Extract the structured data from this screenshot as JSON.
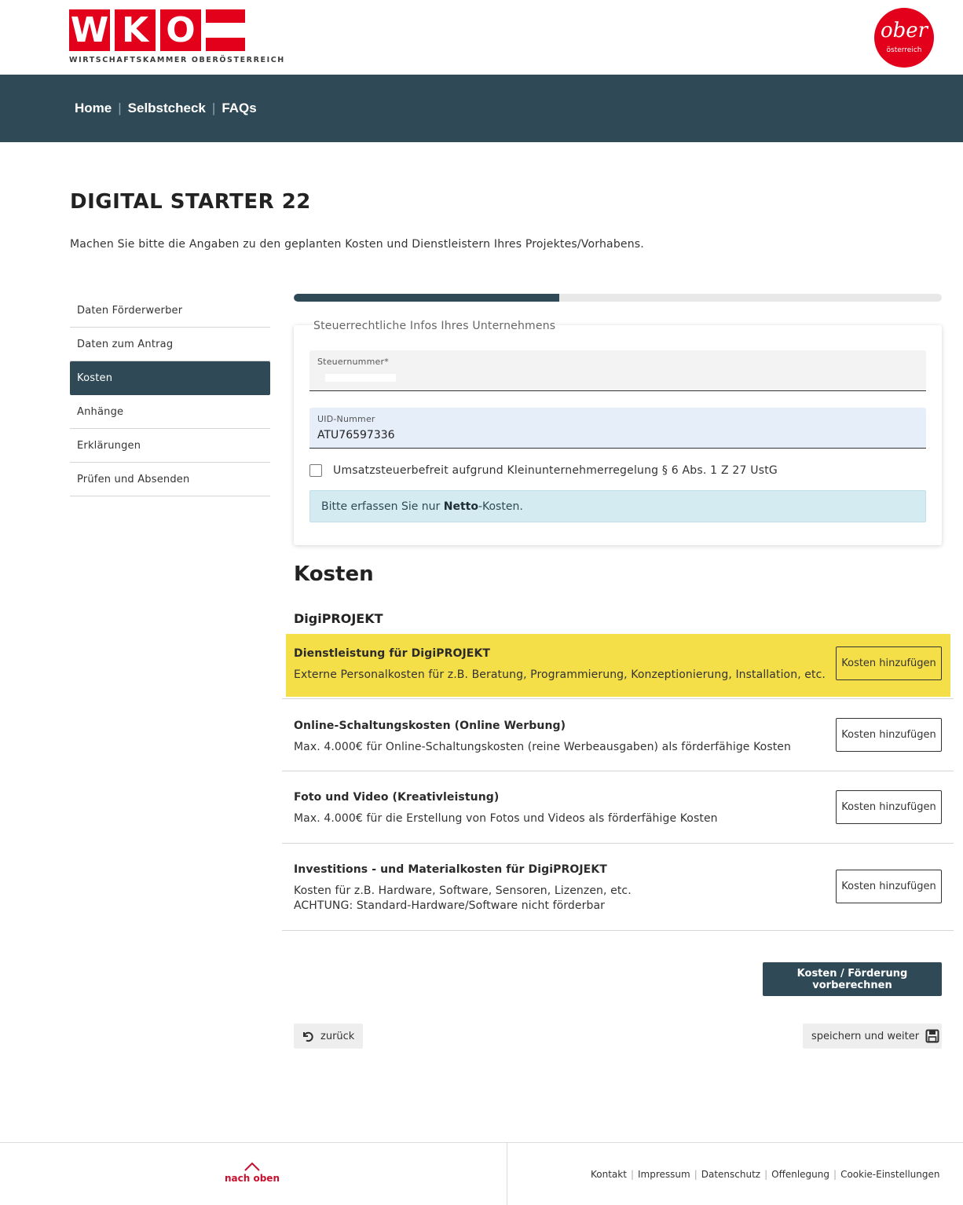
{
  "header": {
    "logo_letters": [
      "W",
      "K",
      "O"
    ],
    "logo_subtitle": "WIRTSCHAFTSKAMMER OBERÖSTERREICH",
    "region_logo_main": "ober",
    "region_logo_sub": "österreich",
    "brand_color": "#e2001a"
  },
  "nav": {
    "items": [
      "Home",
      "Selbstcheck",
      "FAQs"
    ],
    "background": "#2f4a56"
  },
  "page": {
    "title": "DIGITAL STARTER 22",
    "intro": "Machen Sie bitte die Angaben zu den geplanten Kosten und Dienstleistern Ihres Projektes/Vorhabens."
  },
  "sidebar": {
    "items": [
      {
        "label": "Daten Förderwerber"
      },
      {
        "label": "Daten zum Antrag"
      },
      {
        "label": "Kosten"
      },
      {
        "label": "Anhänge"
      },
      {
        "label": "Erklärungen"
      },
      {
        "label": "Prüfen und Absenden"
      }
    ],
    "active": "Kosten"
  },
  "progress": {
    "value": 0.41
  },
  "tax_card": {
    "legend": "Steuerrechtliche Infos Ihres Unternehmens",
    "steuernummer_label": "Steuernummer*",
    "steuernummer_value": "",
    "uid_label": "UID-Nummer",
    "uid_value": "ATU76597336",
    "checkbox_label": "Umsatzsteuerbefreit aufgrund Kleinunternehmerregelung § 6 Abs. 1 Z 27 UstG",
    "checkbox_checked": false,
    "info_prefix": "Bitte erfassen Sie nur ",
    "info_bold": "Netto",
    "info_suffix": "-Kosten."
  },
  "costs": {
    "heading": "Kosten",
    "subheading": "DigiPROJEKT",
    "add_label": "Kosten hinzufügen",
    "rows": [
      {
        "title": "Dienstleistung für DigiPROJEKT",
        "desc": "Externe Personalkosten für z.B. Beratung, Programmierung, Konzeptionierung, Installation, etc.",
        "desc2": ""
      },
      {
        "title": "Online-Schaltungskosten (Online Werbung)",
        "desc": "Max. 4.000€ für Online-Schaltungskosten (reine Werbeausgaben) als förderfähige Kosten",
        "desc2": ""
      },
      {
        "title": "Foto und Video (Kreativleistung)",
        "desc": "Max. 4.000€ für die Erstellung von Fotos und Videos als förderfähige Kosten",
        "desc2": ""
      },
      {
        "title": "Investitions - und Materialkosten für DigiPROJEKT",
        "desc": "Kosten für z.B. Hardware, Software, Sensoren, Lizenzen, etc.",
        "desc2": "ACHTUNG: Standard-Hardware/Software nicht förderbar"
      }
    ],
    "highlight_color": "#f5df48",
    "calc_label": "Kosten / Förderung vorberechnen"
  },
  "actions": {
    "back_label": "zurück",
    "save_label": "speichern und weiter"
  },
  "footer": {
    "up_label": "nach oben",
    "links": [
      "Kontakt",
      "Impressum",
      "Datenschutz",
      "Offenlegung",
      "Cookie-Einstellungen"
    ]
  }
}
